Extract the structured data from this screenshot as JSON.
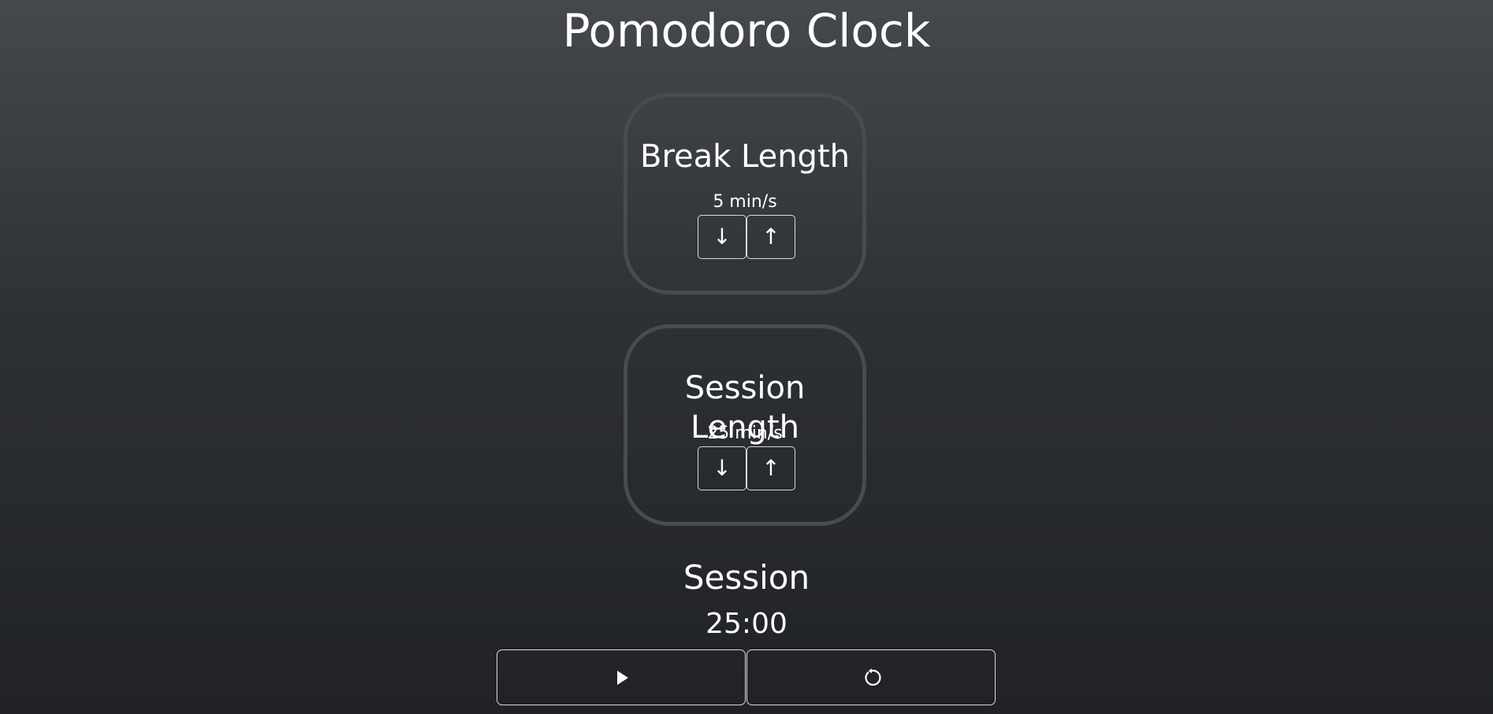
{
  "app": {
    "title": "Pomodoro Clock"
  },
  "break_card": {
    "title": "Break Length",
    "value": "5 min/s",
    "down_icon": "arrow-down-icon",
    "up_icon": "arrow-up-icon",
    "down_label": "↓",
    "up_label": "↑"
  },
  "session_card": {
    "title": "Session Length",
    "value": "25 min/s",
    "down_icon": "arrow-down-icon",
    "up_icon": "arrow-up-icon",
    "down_label": "↓",
    "up_label": "↑"
  },
  "timer": {
    "label": "Session",
    "time": "25:00"
  },
  "controls": {
    "play_icon": "play-icon",
    "reset_icon": "reset-icon"
  },
  "colors": {
    "card_border": "#474b52",
    "button_border": "#d9dadc",
    "text": "#ffffff"
  }
}
